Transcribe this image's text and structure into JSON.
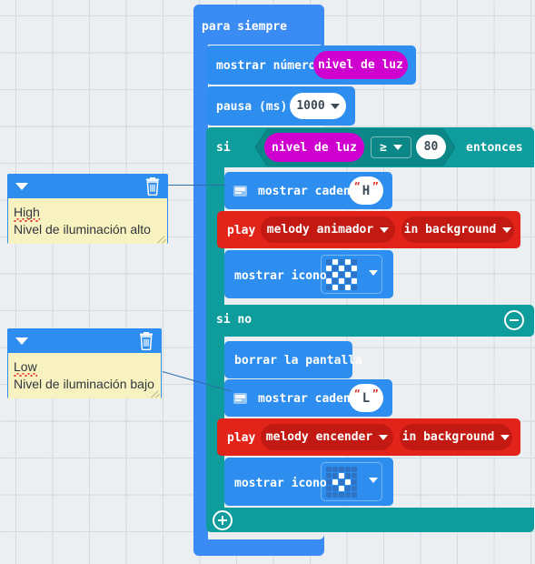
{
  "app": {
    "name": "MakeCode micro:bit block editor",
    "language": "es"
  },
  "workspace": {
    "background_color": "#eceff1",
    "grid_dot_color": "#d6dde3"
  },
  "blocks": {
    "forever": {
      "label": "para siempre",
      "color": "#3b8bf4"
    },
    "show_number": {
      "label": "mostrar número",
      "color": "#2e8eef",
      "value_block": {
        "label": "nivel de luz",
        "color": "#cf00cf"
      }
    },
    "pause": {
      "label": "pausa (ms)",
      "color": "#2e8eef",
      "value": "1000",
      "dropdown_icon": "chevron-down-icon"
    },
    "if_then": {
      "label_if": "si",
      "label_then": "entonces",
      "label_else": "si no",
      "color": "#0f9c9c",
      "condition": {
        "left": {
          "label": "nivel de luz",
          "color": "#cf00cf"
        },
        "operator": "≥",
        "operator_dropdown_icon": "chevron-down-icon",
        "right": "80"
      },
      "minus_button": "minus-icon",
      "plus_button": "plus-icon"
    },
    "then_branch": [
      {
        "type": "show_string",
        "label": "mostrar cadena",
        "color": "#2e8eef",
        "text_value": "H",
        "has_comment_icon": true,
        "comment_icon": "comment-icon"
      },
      {
        "type": "play_melody",
        "label": "play",
        "color": "#e2231a",
        "melody": "melody animador",
        "melody_dropdown_icon": "chevron-down-icon",
        "mode": "in background",
        "mode_dropdown_icon": "chevron-down-icon"
      },
      {
        "type": "show_icon",
        "label": "mostrar icono",
        "color": "#2e8eef",
        "icon_name": "chessboard-icon",
        "dropdown_icon": "chevron-down-icon",
        "led_matrix": [
          [
            0,
            1,
            0,
            1,
            0
          ],
          [
            1,
            0,
            1,
            0,
            1
          ],
          [
            0,
            1,
            0,
            1,
            0
          ],
          [
            1,
            0,
            1,
            0,
            1
          ],
          [
            0,
            1,
            0,
            1,
            0
          ]
        ]
      }
    ],
    "else_branch": [
      {
        "type": "clear_screen",
        "label": "borrar la pantalla",
        "color": "#2e8eef"
      },
      {
        "type": "show_string",
        "label": "mostrar cadena",
        "color": "#2e8eef",
        "text_value": "L",
        "has_comment_icon": true,
        "comment_icon": "comment-icon"
      },
      {
        "type": "play_melody",
        "label": "play",
        "color": "#e2231a",
        "melody": "melody encender",
        "melody_dropdown_icon": "chevron-down-icon",
        "mode": "in background",
        "mode_dropdown_icon": "chevron-down-icon"
      },
      {
        "type": "show_icon",
        "label": "mostrar icono",
        "color": "#2e8eef",
        "icon_name": "small-diamond-icon",
        "dropdown_icon": "chevron-down-icon",
        "led_matrix": [
          [
            0,
            0,
            0,
            0,
            0
          ],
          [
            0,
            0,
            1,
            0,
            0
          ],
          [
            0,
            1,
            0,
            1,
            0
          ],
          [
            0,
            0,
            1,
            0,
            0
          ],
          [
            0,
            0,
            0,
            0,
            0
          ]
        ]
      }
    ]
  },
  "comments": [
    {
      "id": "comment-high",
      "line1": "High",
      "line2": "Nivel de iluminación alto",
      "line1_misspelled": true,
      "collapse_icon": "collapse-arrow-icon",
      "delete_icon": "trash-icon",
      "header_color": "#2e8eef",
      "body_color": "#f8f2c0"
    },
    {
      "id": "comment-low",
      "line1": "Low",
      "line2": "Nivel de iluminación bajo",
      "line1_misspelled": true,
      "collapse_icon": "collapse-arrow-icon",
      "delete_icon": "trash-icon",
      "header_color": "#2e8eef",
      "body_color": "#f8f2c0"
    }
  ]
}
